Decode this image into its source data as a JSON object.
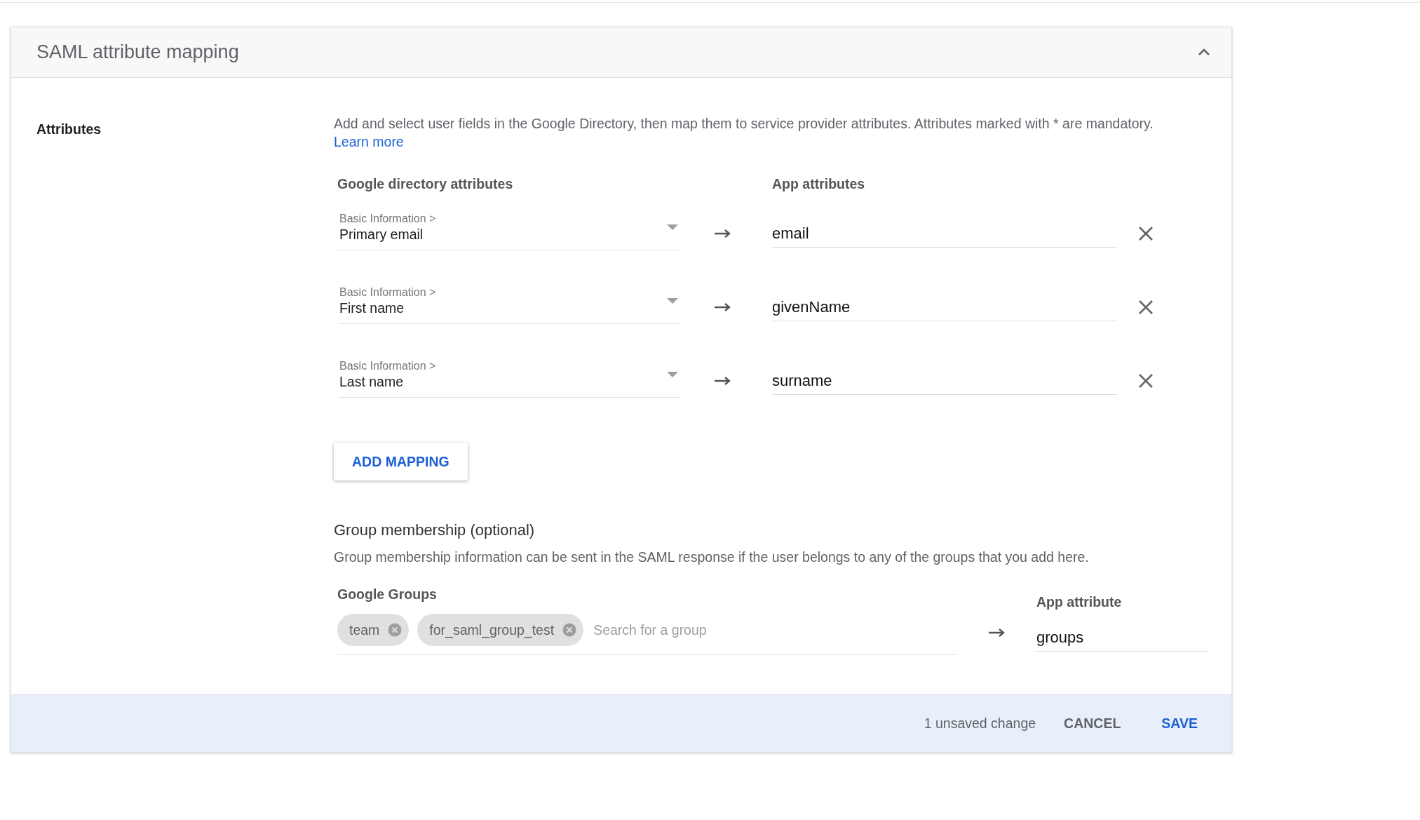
{
  "section": {
    "title": "SAML attribute mapping",
    "expanded": true
  },
  "attributes": {
    "label": "Attributes",
    "description": "Add and select user fields in the Google Directory, then map them to service provider attributes. Attributes marked with * are mandatory.",
    "learn_more": "Learn more",
    "directory_heading": "Google directory attributes",
    "app_heading": "App attributes",
    "mappings": [
      {
        "category": "Basic Information >",
        "field": "Primary email",
        "app_attribute": "email"
      },
      {
        "category": "Basic Information >",
        "field": "First name",
        "app_attribute": "givenName"
      },
      {
        "category": "Basic Information >",
        "field": "Last name",
        "app_attribute": "surname"
      }
    ],
    "add_button": "ADD MAPPING"
  },
  "group_membership": {
    "heading": "Group membership (optional)",
    "description": "Group membership information can be sent in the SAML response if the user belongs to any of the groups that you add here.",
    "groups_label": "Google Groups",
    "chips": [
      "team",
      "for_saml_group_test"
    ],
    "search_placeholder": "Search for a group",
    "app_attribute_label": "App attribute",
    "app_attribute": "groups"
  },
  "footer": {
    "status": "1 unsaved change",
    "cancel": "CANCEL",
    "save": "SAVE"
  }
}
